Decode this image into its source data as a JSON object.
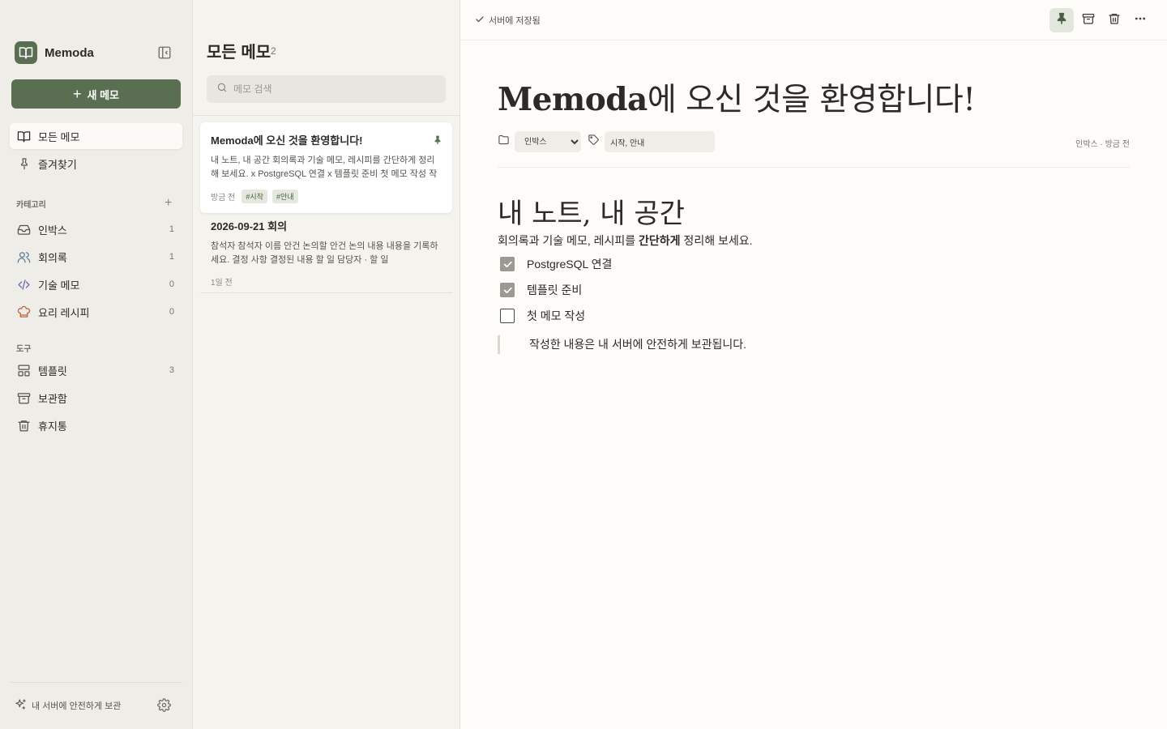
{
  "sidebar": {
    "app_name": "Memoda",
    "new_memo": "새 메모",
    "nav": [
      {
        "label": "모든 메모"
      },
      {
        "label": "즐겨찾기"
      }
    ],
    "categories_label": "카테고리",
    "categories": [
      {
        "label": "인박스",
        "count": "1"
      },
      {
        "label": "회의록",
        "count": "1"
      },
      {
        "label": "기술 메모",
        "count": "0"
      },
      {
        "label": "요리 레시피",
        "count": "0"
      }
    ],
    "tools_label": "도구",
    "tools": [
      {
        "label": "템플릿",
        "count": "3"
      },
      {
        "label": "보관함"
      },
      {
        "label": "휴지통"
      }
    ],
    "footer_text": "내 서버에 안전하게 보관"
  },
  "list": {
    "title": "모든 메모",
    "count": "2",
    "search_placeholder": "메모 검색",
    "notes": [
      {
        "title": "Memoda에 오신 것을 환영합니다!",
        "snippet": "내 노트, 내 공간 회의록과 기술 메모, 레시피를 간단하게 정리해 보세요. x PostgreSQL 연결 x 템플릿 준비 첫 메모 작성 작성한 내용은 내 서버에 안전하게 보관됩니다.",
        "time": "방금 전",
        "tags": [
          "#시작",
          "#안내"
        ]
      },
      {
        "title": "2026-09-21 회의",
        "snippet": "참석자 참석자 이름 안건 논의할 안건 논의 내용 내용을 기록하세요. 결정 사항 결정된 내용 할 일 담당자 · 할 일",
        "time": "1일 전"
      }
    ]
  },
  "editor": {
    "saved_status": "서버에 저장됨",
    "title_bold": "Memoda",
    "title_rest": "에 오신 것을 환영합니다!",
    "folder": "인박스",
    "tags": "시작, 안내",
    "meta_right": "인박스 · 방금 전",
    "heading": "내 노트, 내 공간",
    "para_before": "회의록과 기술 메모, 레시피를 ",
    "para_bold": "간단하게",
    "para_after": " 정리해 보세요.",
    "todos": [
      {
        "label": "PostgreSQL 연결",
        "checked": true
      },
      {
        "label": "템플릿 준비",
        "checked": true
      },
      {
        "label": "첫 메모 작성",
        "checked": false
      }
    ],
    "quote": "작성한 내용은 내 서버에 안전하게 보관됩니다."
  },
  "icons": {
    "brand": "book-open-icon",
    "collapse": "sidebar-collapse-icon",
    "pin": "pin-icon",
    "archive": "archive-icon",
    "trash": "trash-icon",
    "more": "more-horizontal-icon",
    "settings": "gear-icon"
  },
  "colors": {
    "accent": "#5a6f52",
    "sidebar_bg": "#eeede8",
    "list_bg": "#f5f3ee",
    "editor_bg": "#fdfcf8",
    "tag_bg": "#e4e8dd"
  }
}
